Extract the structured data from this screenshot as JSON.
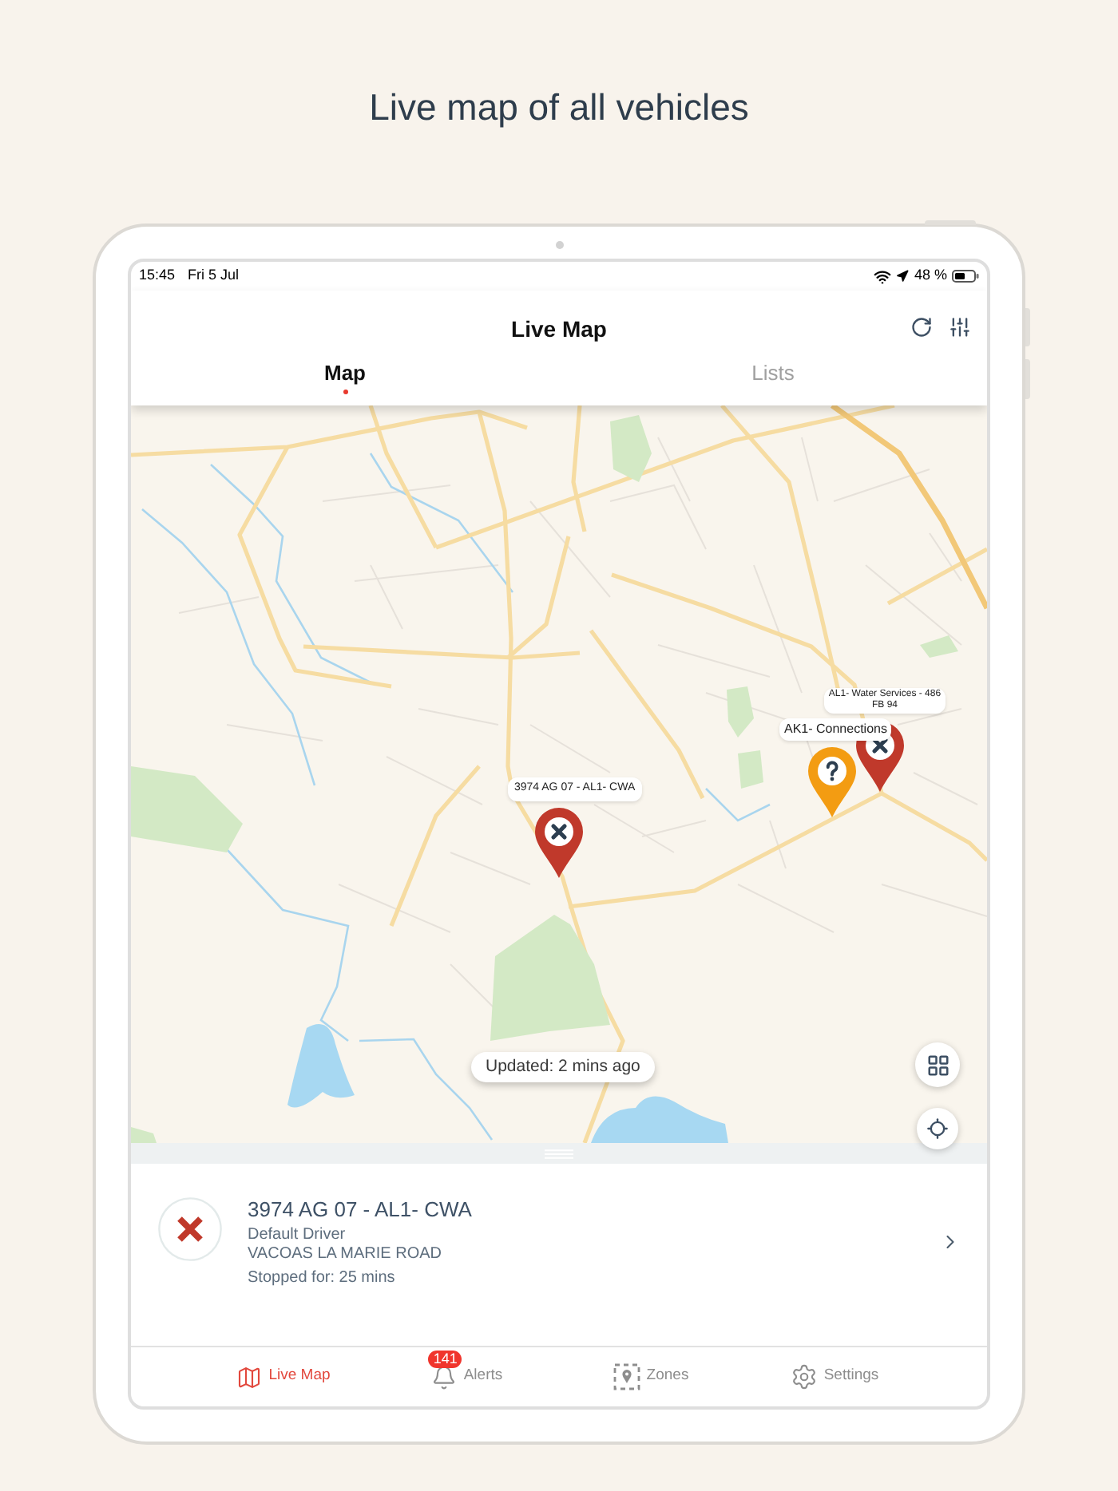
{
  "page_title": "Live map of all vehicles",
  "status_bar": {
    "time": "15:45",
    "date": "Fri 5 Jul",
    "battery": "48 %"
  },
  "header": {
    "title": "Live Map"
  },
  "tabs": [
    {
      "label": "Map",
      "selected": true
    },
    {
      "label": "Lists",
      "selected": false
    }
  ],
  "map": {
    "markers": [
      {
        "label": "3974 AG 07 - AL1- CWA",
        "kind": "stopped",
        "color": "#c0392b"
      },
      {
        "label": "AK1- Connections",
        "kind": "unknown",
        "color": "#f39c12"
      },
      {
        "label": "AL1- Water Services - 486 FB 94",
        "kind": "stopped",
        "color": "#c0392b"
      }
    ],
    "updated": "Updated: 2 mins ago"
  },
  "vehicle": {
    "kind": "stopped",
    "name": "3974 AG 07 - AL1- CWA",
    "driver": "Default Driver",
    "address": "VACOAS LA MARIE ROAD",
    "status": "Stopped for: 25 mins"
  },
  "tab_bar": [
    {
      "label": "Live Map",
      "kind": "map",
      "selected": true
    },
    {
      "label": "Alerts",
      "kind": "alerts",
      "selected": false,
      "badge": "141"
    },
    {
      "label": "Zones",
      "kind": "zones",
      "selected": false
    },
    {
      "label": "Settings",
      "kind": "settings",
      "selected": false
    }
  ]
}
